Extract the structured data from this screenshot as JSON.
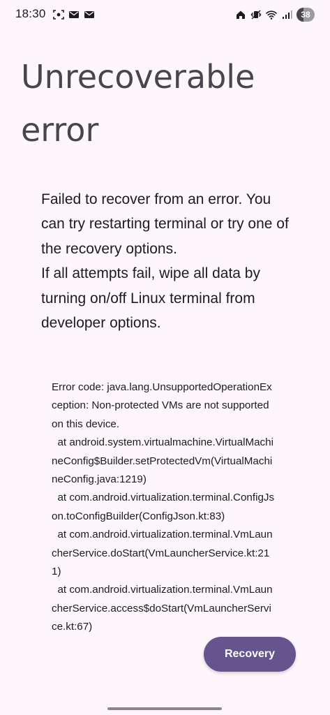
{
  "status_bar": {
    "time": "18:30",
    "left_icons": [
      "screenshot-icon",
      "gmail-icon",
      "mail-icon"
    ],
    "right_icons": [
      "home-icon",
      "vibrate-icon",
      "wifi-icon",
      "signal-icon"
    ],
    "battery_level": "38",
    "battery_fraction": 0.38
  },
  "title": "Unrecoverable error",
  "message": {
    "line1": "Failed to recover from an error. You can try restarting terminal or try one of the recovery options.",
    "line2": "If all attempts fail, wipe all data by turning on/off Linux terminal from developer options."
  },
  "error_detail": "Error code: java.lang.UnsupportedOperationException: Non-protected VMs are not supported on this device.\n  at android.system.virtualmachine.VirtualMachineConfig$Builder.setProtectedVm(VirtualMachineConfig.java:1219)\n  at com.android.virtualization.terminal.ConfigJson.toConfigBuilder(ConfigJson.kt:83)\n  at com.android.virtualization.terminal.VmLauncherService.doStart(VmLauncherService.kt:211)\n  at com.android.virtualization.terminal.VmLauncherService.access$doStart(VmLauncherService.kt:67)",
  "recovery_button": {
    "label": "Recovery"
  },
  "colors": {
    "background": "#fdf7fc",
    "accent": "#65558f",
    "title_text": "#49454f"
  }
}
